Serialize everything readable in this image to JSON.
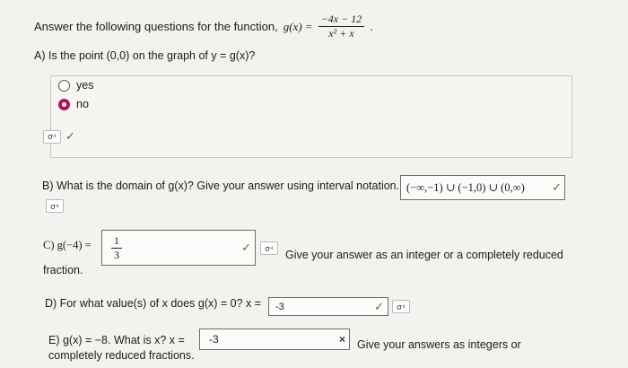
{
  "header": {
    "prefix": "Answer the following questions for the function,",
    "func": "g(x) =",
    "numerator": "−4x − 12",
    "denominator": "x² + x",
    "suffix": "."
  },
  "partA": {
    "question": "A) Is the point (0,0) on the graph of y = g(x)?",
    "options": [
      {
        "label": "yes",
        "selected": false
      },
      {
        "label": "no",
        "selected": true
      }
    ],
    "status": "correct"
  },
  "partB": {
    "question": "B) What is the domain of g(x)? Give your answer using interval notation.",
    "answer": "(−∞,−1) ∪ (−1,0) ∪ (0,∞)",
    "status": "correct"
  },
  "partC": {
    "label": "C) g(−4) =",
    "answer_num": "1",
    "answer_den": "3",
    "instruction": "Give your answer as an integer or a completely reduced",
    "instruction_tail": "fraction.",
    "status": "correct"
  },
  "partD": {
    "question": "D) For what value(s) of x does g(x) = 0? x =",
    "answer": "-3",
    "status": "correct"
  },
  "partE": {
    "question": "E) g(x) = −8. What is x? x =",
    "answer": "-3",
    "tail": "completely reduced fractions.",
    "instruction": "Give your answers as integers or",
    "status": "incorrect"
  },
  "icons": {
    "tool": "σ⁴",
    "check": "✓",
    "cross": "×"
  },
  "colors": {
    "radio_selected": "#b3135a",
    "check": "#3c7a3c"
  }
}
